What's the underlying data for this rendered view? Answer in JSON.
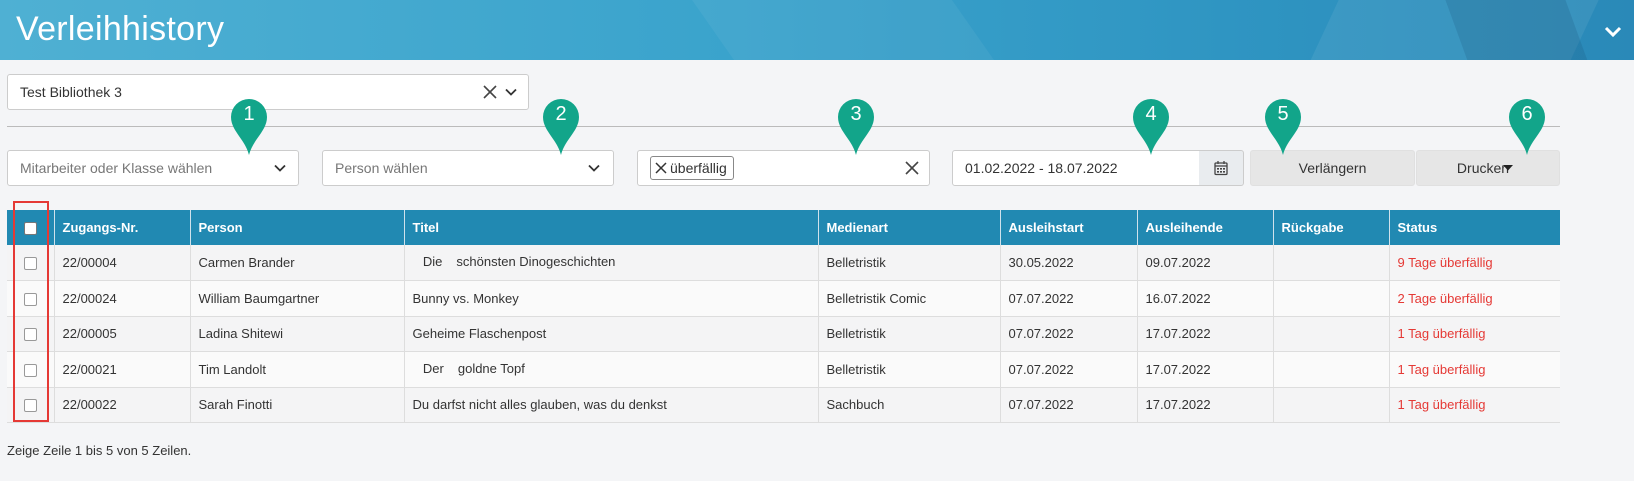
{
  "header": {
    "title": "Verleihhistory"
  },
  "library_select": {
    "value": "Test Bibliothek 3"
  },
  "filters": {
    "staff_placeholder": "Mitarbeiter oder Klasse wählen",
    "person_placeholder": "Person wählen",
    "status_tag": "überfällig",
    "date_range": "01.02.2022 - 18.07.2022"
  },
  "buttons": {
    "extend": "Verlängern",
    "print": "Drucken"
  },
  "markers": [
    "1",
    "2",
    "3",
    "4",
    "5",
    "6"
  ],
  "table": {
    "columns": [
      "Zugangs-Nr.",
      "Person",
      "Titel",
      "Medienart",
      "Ausleihstart",
      "Ausleihende",
      "Rückgabe",
      "Status"
    ],
    "rows": [
      {
        "nr": "22/00004",
        "person": "Carmen Brander",
        "title": "Die schönsten Dinogeschichten",
        "media": "Belletristik",
        "start": "30.05.2022",
        "end": "09.07.2022",
        "return": "",
        "status": "9 Tage überfällig"
      },
      {
        "nr": "22/00024",
        "person": "William Baumgartner",
        "title": "Bunny vs. Monkey",
        "media": "Belletristik Comic",
        "start": "07.07.2022",
        "end": "16.07.2022",
        "return": "",
        "status": "2 Tage überfällig"
      },
      {
        "nr": "22/00005",
        "person": "Ladina Shitewi",
        "title": "Geheime Flaschenpost",
        "media": "Belletristik",
        "start": "07.07.2022",
        "end": "17.07.2022",
        "return": "",
        "status": "1 Tag überfällig"
      },
      {
        "nr": "22/00021",
        "person": "Tim Landolt",
        "title": "Der goldne Topf",
        "media": "Belletristik",
        "start": "07.07.2022",
        "end": "17.07.2022",
        "return": "",
        "status": "1 Tag überfällig"
      },
      {
        "nr": "22/00022",
        "person": "Sarah Finotti",
        "title": "Du darfst nicht alles glauben, was du denkst",
        "media": "Sachbuch",
        "start": "07.07.2022",
        "end": "17.07.2022",
        "return": "",
        "status": "1 Tag überfällig"
      }
    ]
  },
  "footer": {
    "text": "Zeige Zeile 1 bis 5 von 5 Zeilen."
  },
  "colors": {
    "header_bg": "#3aa3cc",
    "table_header": "#2189b2",
    "marker": "#12a58a",
    "overdue": "#e53935",
    "highlight": "#e53935"
  },
  "icons": [
    "clear-x-icon",
    "chevron-down-icon",
    "calendar-icon",
    "caret-down-icon",
    "tag-remove-icon"
  ]
}
